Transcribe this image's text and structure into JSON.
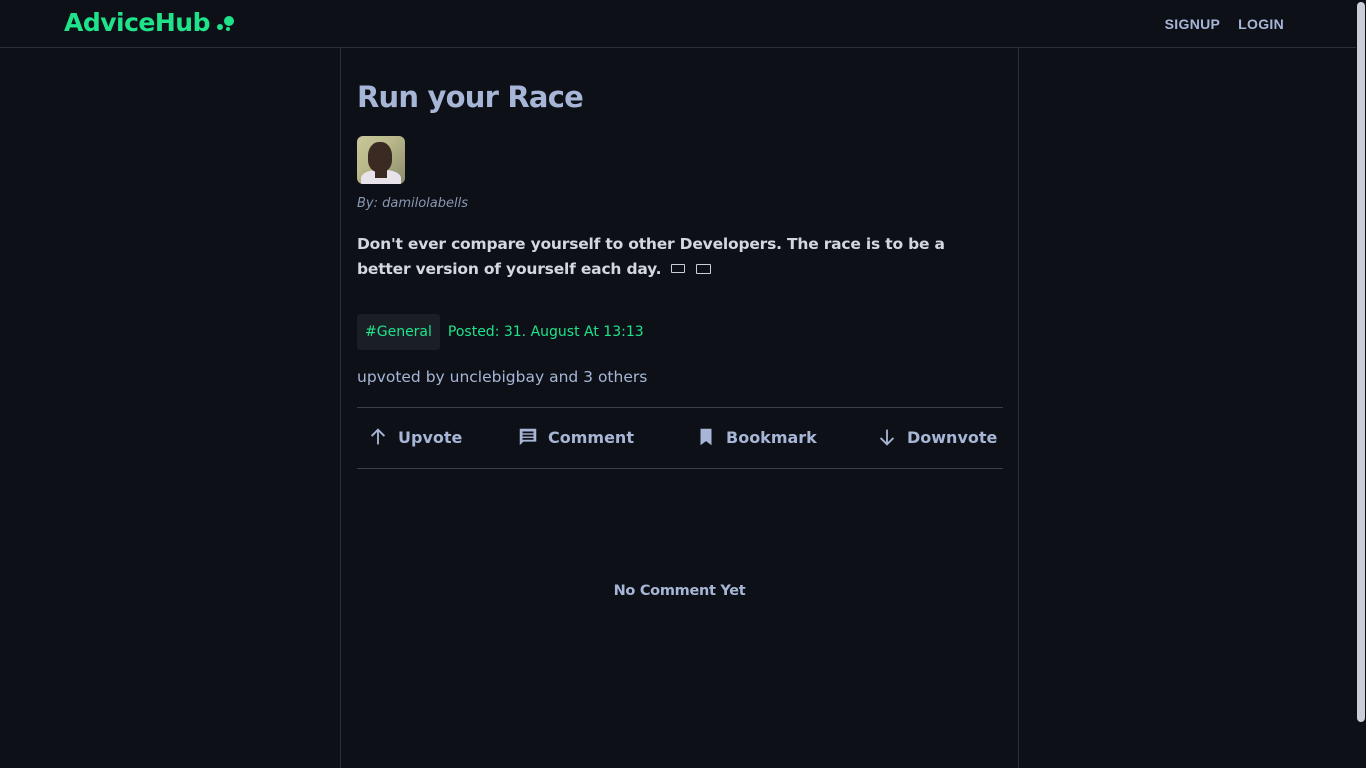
{
  "header": {
    "logo_text": "AdviceHub",
    "signup_label": "SIGNUP",
    "login_label": "LOGIN"
  },
  "post": {
    "title": "Run your Race",
    "author_byline": "By: damilolabells",
    "body": "Don't ever compare yourself to other Developers. The race is to be a better version of yourself each day.",
    "tag": "#General",
    "posted": "Posted: 31. August At 13:13",
    "upvoted_by": "upvoted by unclebigbay and 3 others"
  },
  "actions": {
    "upvote_label": "Upvote",
    "comment_label": "Comment",
    "bookmark_label": "Bookmark",
    "downvote_label": "Downvote"
  },
  "comments": {
    "empty_text": "No Comment Yet"
  },
  "colors": {
    "accent": "#1ee38a",
    "background": "#0d1117",
    "text": "#a7b6d6"
  }
}
